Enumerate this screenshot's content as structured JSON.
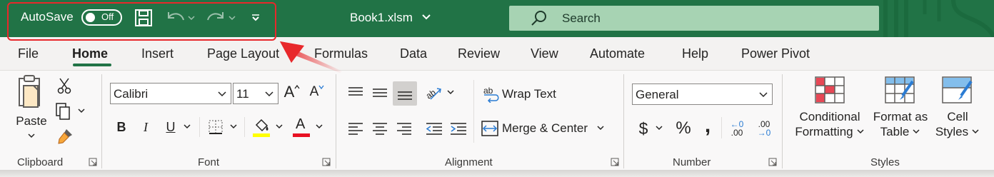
{
  "titlebar": {
    "autosave_label": "AutoSave",
    "autosave_state": "Off",
    "filename": "Book1.xlsm",
    "search_placeholder": "Search",
    "accent_color": "#217346",
    "highlight_color": "#e8282b"
  },
  "tabs": [
    {
      "label": "File"
    },
    {
      "label": "Home",
      "active": true
    },
    {
      "label": "Insert"
    },
    {
      "label": "Page Layout"
    },
    {
      "label": "Formulas"
    },
    {
      "label": "Data"
    },
    {
      "label": "Review"
    },
    {
      "label": "View"
    },
    {
      "label": "Automate"
    },
    {
      "label": "Help"
    },
    {
      "label": "Power Pivot"
    }
  ],
  "clipboard": {
    "paste_label": "Paste",
    "group_label": "Clipboard"
  },
  "font": {
    "name": "Calibri",
    "size": "11",
    "bold": "B",
    "italic": "I",
    "underline": "U",
    "font_color_letter": "A",
    "grow_letter": "A",
    "shrink_letter": "A",
    "highlight_swatch": "#ffff00",
    "font_color_swatch": "#e81123",
    "group_label": "Font"
  },
  "alignment": {
    "wrap_text": "Wrap Text",
    "merge_center": "Merge & Center",
    "wrap_glyph": "ab",
    "group_label": "Alignment"
  },
  "number": {
    "format": "General",
    "currency": "$",
    "percent": "%",
    "comma": ",",
    "increase_decimal_top": "←0",
    "increase_decimal_bottom": ".00",
    "decrease_decimal_top": ".00",
    "decrease_decimal_bottom": "→0",
    "group_label": "Number"
  },
  "styles": {
    "conditional_formatting_1": "Conditional",
    "conditional_formatting_2": "Formatting",
    "format_as_table_1": "Format as",
    "format_as_table_2": "Table",
    "cell_styles_1": "Cell",
    "cell_styles_2": "Styles",
    "group_label": "Styles"
  }
}
